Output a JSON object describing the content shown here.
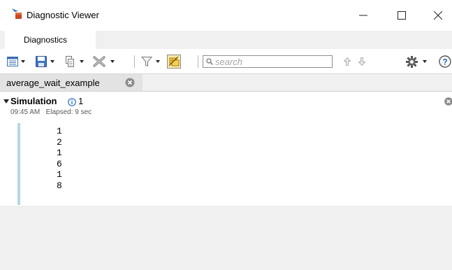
{
  "window": {
    "title": "Diagnostic Viewer",
    "icons": {
      "app": "simulink-arrow-icon",
      "minimize": "minimize-icon",
      "maximize": "maximize-icon",
      "close": "close-icon"
    }
  },
  "tabs": [
    {
      "label": "Diagnostics",
      "selected": true
    }
  ],
  "toolbar": {
    "items": [
      "view-options-icon",
      "save-icon",
      "copy-icon",
      "clear-icon",
      "filter-icon",
      "group-by-icon"
    ],
    "search": {
      "placeholder": "search",
      "value": ""
    },
    "nav": [
      "search-up-icon",
      "search-down-icon"
    ],
    "right": [
      "settings-gear-icon",
      "help-icon"
    ]
  },
  "model_tab": {
    "label": "average_wait_example",
    "close_icon": "tab-close-icon"
  },
  "simulation": {
    "label": "Simulation",
    "info_icon": "info-icon",
    "count": "1",
    "time": "09:45 AM   Elapsed: 9 sec",
    "output": [
      "1",
      "2",
      "1",
      "6",
      "1",
      "8"
    ]
  },
  "colors": {
    "accent_bar": "#b5d8e3",
    "group_by_active": "#f5c242",
    "icon_blue": "#2a6ec8"
  }
}
